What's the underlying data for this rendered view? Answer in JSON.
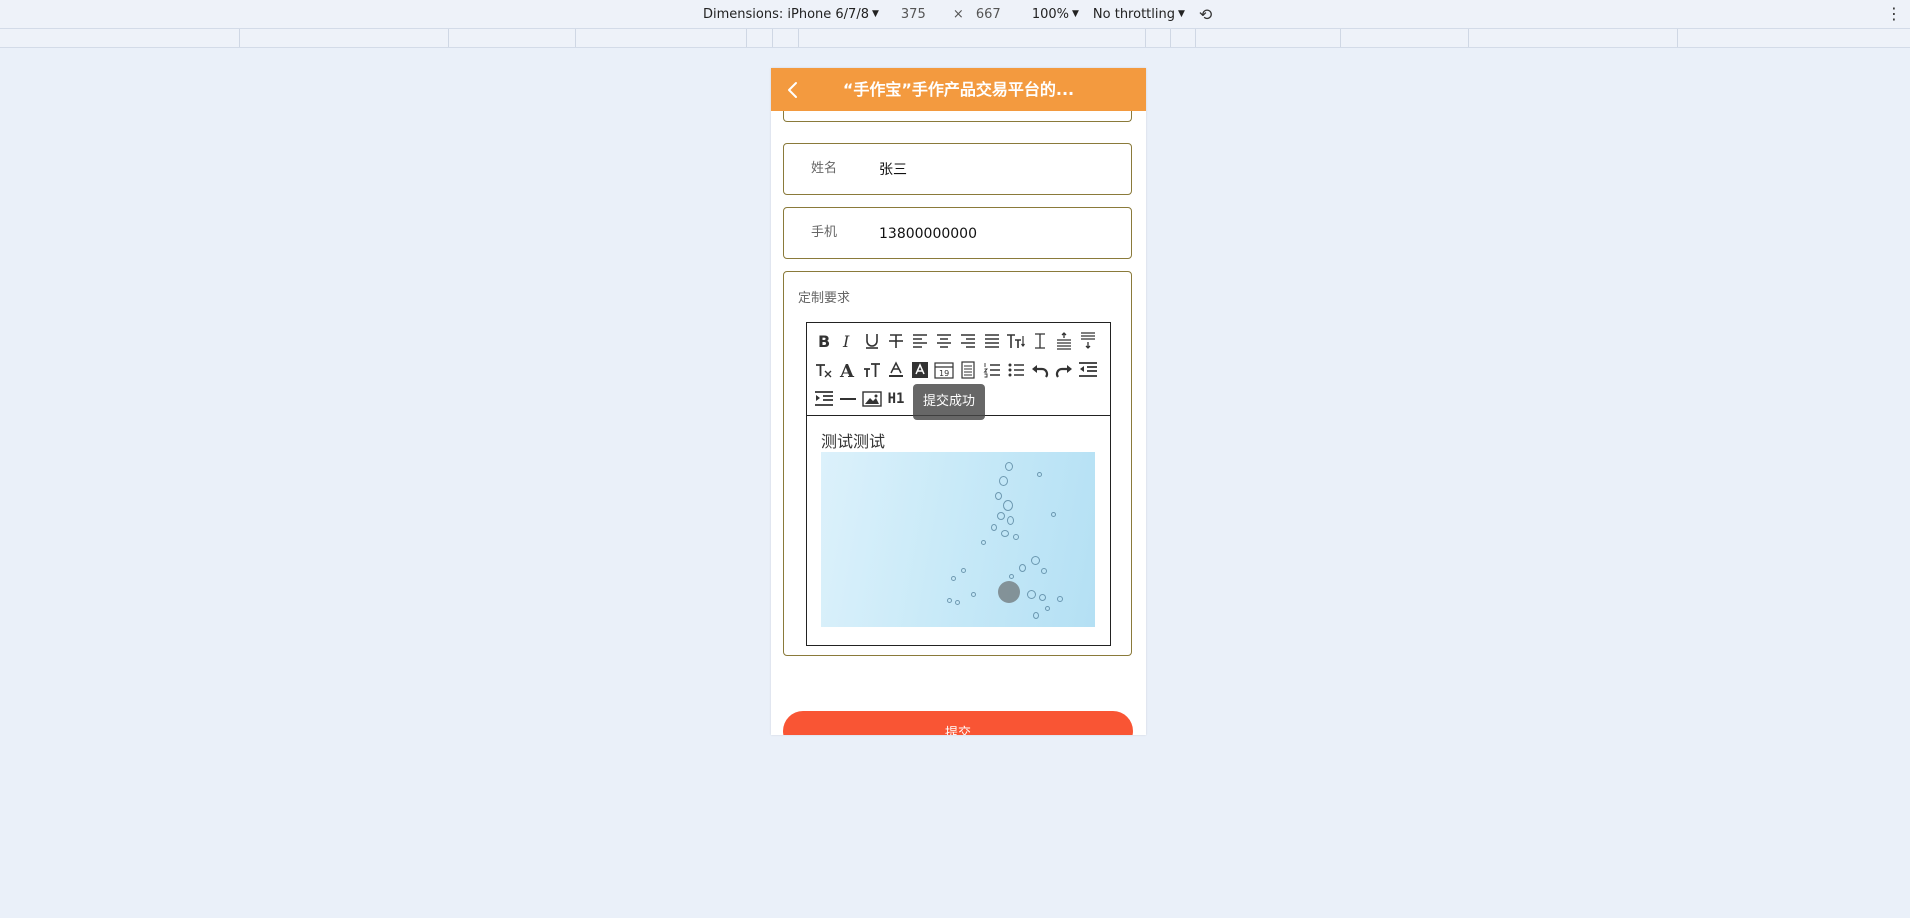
{
  "devtools": {
    "device_label": "Dimensions: iPhone 6/7/8",
    "width": "375",
    "times": "×",
    "height": "667",
    "zoom": "100%",
    "throttle": "No throttling"
  },
  "header": {
    "title": "“手作宝”手作产品交易平台的..."
  },
  "form": {
    "name_label": "姓名",
    "name_value": "张三",
    "phone_label": "手机",
    "phone_value": "13800000000",
    "custom_label": "定制要求",
    "editor_text": "测试测试",
    "submit_label": "提交"
  },
  "toolbar": {
    "row1": [
      "bold-icon",
      "italic-icon",
      "underline-icon",
      "strikethrough-icon",
      "align-left-icon",
      "align-center-icon",
      "align-right-icon",
      "align-justify-icon",
      "font-size-icon",
      "line-height-icon",
      "paragraph-spacing-top-icon",
      "paragraph-spacing-bottom-icon"
    ],
    "row2": [
      "clear-format-icon",
      "font-family-icon",
      "font-size-small-icon",
      "font-color-icon",
      "background-color-icon",
      "date-icon",
      "time-icon",
      "ordered-list-icon",
      "unordered-list-icon",
      "undo-icon",
      "redo-icon",
      "outdent-icon"
    ],
    "row3": [
      "indent-icon",
      "horizontal-rule-icon",
      "image-icon",
      "heading-icon"
    ],
    "heading_label": "H1"
  },
  "toast": {
    "message": "提交成功"
  },
  "colors": {
    "header": "#f39a3f",
    "submit": "#f95534",
    "field_border": "#8a7a3a"
  }
}
